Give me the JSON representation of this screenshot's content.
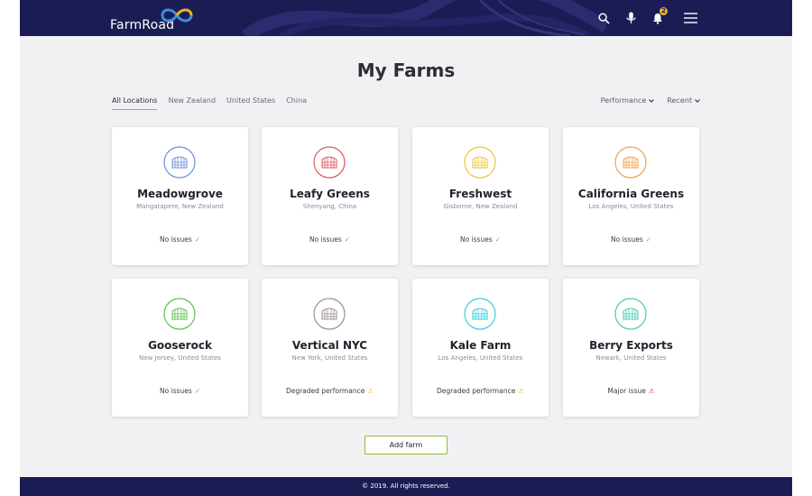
{
  "header": {
    "logo_text": "FarmRoad",
    "icons": [
      "search-icon",
      "microphone-icon",
      "bell-icon",
      "menu-icon"
    ],
    "notification_count": "2"
  },
  "page_title": "My Farms",
  "filters": {
    "tabs": [
      "All Locations",
      "New Zealand",
      "United States",
      "China"
    ],
    "active_tab": "All Locations",
    "sort_by": "Performance",
    "order": "Recent"
  },
  "farms": [
    {
      "name": "Meadowgrove",
      "location": "Mangatapere, New Zealand",
      "status": "No issues",
      "status_type": "ok",
      "color": "#6f8fd6"
    },
    {
      "name": "Leafy Greens",
      "location": "Shenyang, China",
      "status": "No issues",
      "status_type": "ok",
      "color": "#e0565b"
    },
    {
      "name": "Freshwest",
      "location": "Gisborne, New Zealand",
      "status": "No issues",
      "status_type": "ok",
      "color": "#f2c230"
    },
    {
      "name": "California Greens",
      "location": "Los Angeles, United States",
      "status": "No issues",
      "status_type": "ok",
      "color": "#f0a04a"
    },
    {
      "name": "Gooserock",
      "location": "New Jersey, United States",
      "status": "No issues",
      "status_type": "ok",
      "color": "#5cbf4e"
    },
    {
      "name": "Vertical NYC",
      "location": "New York, United States",
      "status": "Degraded performance",
      "status_type": "warning",
      "color": "#9a8f96"
    },
    {
      "name": "Kale Farm",
      "location": "Los Angeles, United States",
      "status": "Degraded performance",
      "status_type": "warning",
      "color": "#3ec9dd"
    },
    {
      "name": "Berry Exports",
      "location": "Newark, United States",
      "status": "Major issue",
      "status_type": "error",
      "color": "#4ec6b0"
    }
  ],
  "status_colors": {
    "ok": "#7ab22e",
    "warning": "#f0b81c",
    "error": "#d83a3a"
  },
  "add_farm_label": "Add farm",
  "footer_text": "© 2019. All rights reserved."
}
